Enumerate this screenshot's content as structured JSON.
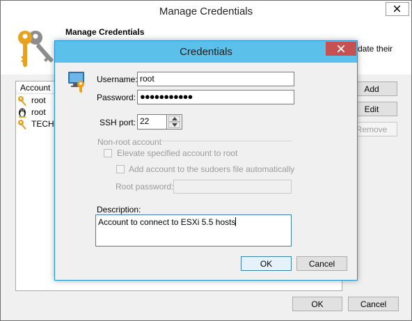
{
  "outer_window": {
    "title": "Manage Credentials",
    "header_title": "Manage Credentials",
    "header_desc_visible": "date their",
    "list": {
      "column_header": "Account",
      "rows": [
        {
          "icon": "key-icon",
          "label": "root"
        },
        {
          "icon": "linux-penguin-icon",
          "label": "root"
        },
        {
          "icon": "key-icon",
          "label": "TECHV"
        }
      ]
    },
    "buttons": {
      "add": "Add",
      "edit": "Edit",
      "remove": "Remove",
      "ok": "OK",
      "cancel": "Cancel"
    }
  },
  "dialog": {
    "title": "Credentials",
    "username_label": "Username:",
    "username_value": "root",
    "password_label": "Password:",
    "password_value": "●●●●●●●●●●●",
    "ssh_port_label": "SSH port:",
    "ssh_port_value": "22",
    "nonroot_group_label": "Non-root account",
    "elevate_label": "Elevate specified account to root",
    "sudoers_label": "Add account to the sudoers file automatically",
    "root_password_label": "Root password:",
    "description_label": "Description:",
    "description_value": "Account to connect to ESXi 5.5 hosts",
    "ok": "OK",
    "cancel": "Cancel"
  },
  "colors": {
    "dialog_titlebar": "#5bc0ea",
    "close_button": "#c75050",
    "focus_border": "#3c7fb1"
  }
}
